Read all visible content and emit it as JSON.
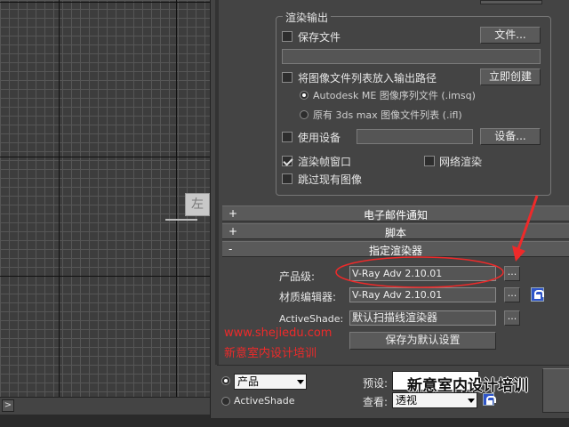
{
  "render_output": {
    "title": "渲染输出",
    "save_file_label": "保存文件",
    "save_file_checked": false,
    "files_button": "文件...",
    "output_path": "",
    "put_image_list_label": "将图像文件列表放入输出路径",
    "put_image_list_checked": false,
    "create_now_button": "立即创建",
    "radio_imsq_label": "Autodesk ME 图像序列文件 (.imsq)",
    "radio_ifl_label": "原有 3ds max 图像文件列表 (.ifl)",
    "use_device_label": "使用设备",
    "use_device_checked": false,
    "device_value": "",
    "devices_button": "设备...",
    "render_frame_window_label": "渲染帧窗口",
    "render_frame_window_checked": true,
    "net_render_label": "网络渲染",
    "net_render_checked": false,
    "skip_existing_label": "跳过现有图像",
    "skip_existing_checked": false
  },
  "rollouts": {
    "email": {
      "sign": "+",
      "title": "电子邮件通知"
    },
    "scripts": {
      "sign": "+",
      "title": "脚本"
    },
    "assign_renderer": {
      "sign": "-",
      "title": "指定渲染器"
    }
  },
  "assign_renderer": {
    "production_label": "产品级:",
    "production_value": "V-Ray Adv 2.10.01",
    "material_editor_label": "材质编辑器:",
    "material_editor_value": "V-Ray Adv 2.10.01",
    "activeshade_label": "ActiveShade:",
    "activeshade_value": "默认扫描线渲染器",
    "choose_button": "...",
    "save_default_button": "保存为默认设置"
  },
  "watermark": {
    "url": "www.shejiedu.com",
    "name": "新意室内设计培训",
    "banner": "新意室内设计培训"
  },
  "bottom_bar": {
    "mode_value": "产品",
    "activeshade_label": "ActiveShade",
    "preset_label": "预设:",
    "view_label": "查看:",
    "view_value": "透视"
  },
  "viewport": {
    "gizmo_text": "左",
    "arrow": ">"
  },
  "colors": {
    "annotation_red": "#ee2a2a",
    "lock_blue": "#2f55c8"
  }
}
